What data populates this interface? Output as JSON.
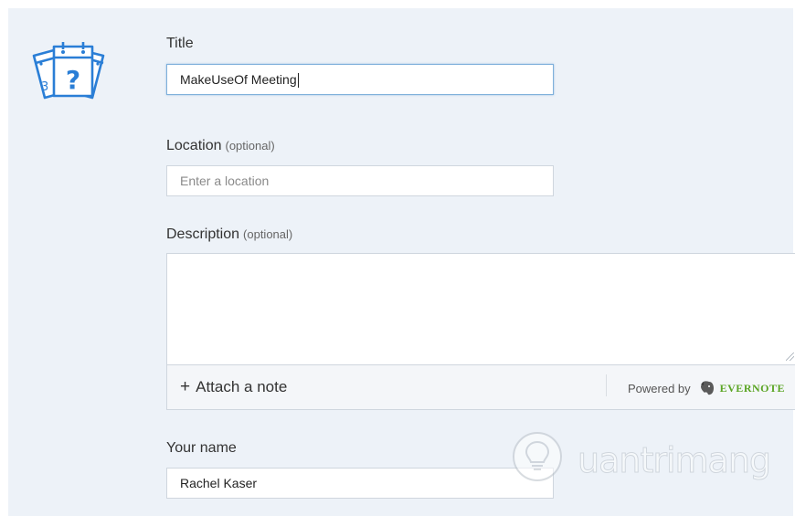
{
  "form": {
    "title": {
      "label": "Title",
      "value": "MakeUseOf Meeting"
    },
    "location": {
      "label": "Location",
      "optional": "(optional)",
      "placeholder": "Enter a location"
    },
    "description": {
      "label": "Description",
      "optional": "(optional)",
      "value": ""
    },
    "attach_note": {
      "plus": "+",
      "label": "Attach a note"
    },
    "powered_by": {
      "text": "Powered by",
      "brand": "EVERNOTE"
    },
    "your_name": {
      "label": "Your name",
      "value": "Rachel Kaser"
    }
  },
  "icons": {
    "logo": "calendar-question-icon",
    "evernote": "evernote-elephant-icon",
    "watermark": "lightbulb-icon"
  },
  "watermark": {
    "text": "uantrimang"
  },
  "colors": {
    "panel_bg": "#edf2f8",
    "logo_blue": "#2a7ed6",
    "focus_border": "#7fb0db",
    "evernote_green": "#5ba525"
  }
}
